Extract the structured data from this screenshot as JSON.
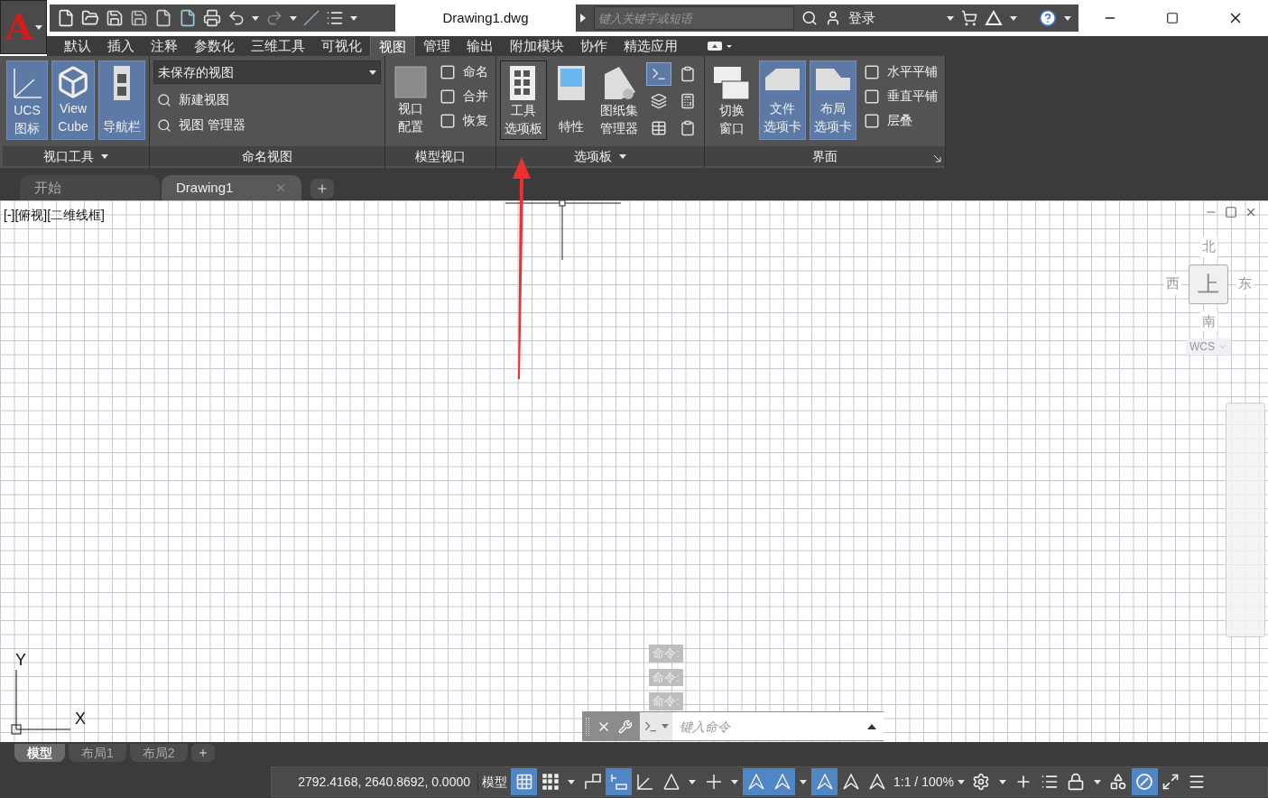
{
  "app_button": {
    "label": "A"
  },
  "title": "Drawing1.dwg",
  "search": {
    "placeholder": "键入关键字或短语"
  },
  "login": "登录",
  "ribbon_tabs": [
    {
      "label": "默认",
      "selected": false
    },
    {
      "label": "插入",
      "selected": false
    },
    {
      "label": "注释",
      "selected": false
    },
    {
      "label": "参数化",
      "selected": false
    },
    {
      "label": "三维工具",
      "selected": false
    },
    {
      "label": "可视化",
      "selected": false
    },
    {
      "label": "视图",
      "selected": true
    },
    {
      "label": "管理",
      "selected": false
    },
    {
      "label": "输出",
      "selected": false
    },
    {
      "label": "附加模块",
      "selected": false
    },
    {
      "label": "协作",
      "selected": false
    },
    {
      "label": "精选应用",
      "selected": false
    }
  ],
  "panels": [
    {
      "title": "视口工具",
      "caret": true,
      "launcher": false,
      "items": [
        {
          "kind": "large",
          "lines": [
            "UCS",
            "图标"
          ],
          "selected": true,
          "highlighted": false
        },
        {
          "kind": "large",
          "lines": [
            "View",
            "Cube"
          ],
          "selected": true,
          "highlighted": false
        },
        {
          "kind": "large",
          "lines": [
            "导航栏"
          ],
          "selected": true,
          "highlighted": false
        }
      ]
    },
    {
      "title": "命名视图",
      "caret": false,
      "launcher": false,
      "items": [
        {
          "kind": "dropdown",
          "value": "未保存的视图",
          "items": [
            "新建视图",
            "视图 管理器"
          ]
        }
      ]
    },
    {
      "title": "模型视口",
      "caret": false,
      "launcher": false,
      "items": [
        {
          "kind": "large",
          "lines": [
            "视口",
            "配置"
          ],
          "selected": false,
          "highlighted": false
        },
        {
          "kind": "column",
          "items": [
            "命名",
            "合并",
            "恢复"
          ]
        }
      ]
    },
    {
      "title": "选项板",
      "caret": true,
      "launcher": false,
      "items": [
        {
          "kind": "large",
          "lines": [
            "工具",
            "选项板"
          ],
          "selected": false,
          "highlighted": true
        },
        {
          "kind": "large",
          "lines": [
            "特性"
          ],
          "selected": false,
          "highlighted": false
        },
        {
          "kind": "large",
          "lines": [
            "图纸集",
            "管理器"
          ],
          "selected": false,
          "highlighted": false
        },
        {
          "kind": "grid",
          "icons": [
            {
              "selected": true
            },
            {
              "selected": false
            },
            {
              "selected": false
            },
            {
              "selected": false
            },
            {
              "selected": false
            },
            {
              "selected": false
            }
          ]
        }
      ]
    },
    {
      "title": "界面",
      "caret": false,
      "launcher": true,
      "items": [
        {
          "kind": "large",
          "lines": [
            "切换",
            "窗口"
          ],
          "selected": false,
          "highlighted": false
        },
        {
          "kind": "large",
          "lines": [
            "文件",
            "选项卡"
          ],
          "selected": true,
          "highlighted": false
        },
        {
          "kind": "large",
          "lines": [
            "布局",
            "选项卡"
          ],
          "selected": true,
          "highlighted": false
        },
        {
          "kind": "column",
          "items": [
            "水平平铺",
            "垂直平铺",
            "层叠"
          ]
        }
      ]
    }
  ],
  "file_tabs": [
    {
      "label": "开始",
      "selected": false
    },
    {
      "label": "Drawing1",
      "selected": true
    }
  ],
  "viewport_label": "[-][俯视][二维线框]",
  "viewcube": {
    "north": "北",
    "west": "西",
    "top": "上",
    "east": "东",
    "south": "南",
    "wcs": "WCS"
  },
  "command_history": [
    "命令:",
    "命令:",
    "命令:"
  ],
  "command_line": {
    "placeholder": "键入命令"
  },
  "ucs": {
    "x": "X",
    "y": "Y"
  },
  "layout_tabs": [
    {
      "label": "模型",
      "selected": true
    },
    {
      "label": "布局1",
      "selected": false
    },
    {
      "label": "布局2",
      "selected": false
    }
  ],
  "status_bar": {
    "coordinates": "2792.4168, 2640.8692, 0.0000",
    "space": "模型",
    "items": [
      {
        "kind": "toggle",
        "on": true
      },
      {
        "kind": "toggle",
        "on": false
      },
      {
        "kind": "caret"
      },
      {
        "kind": "toggle",
        "on": false
      },
      {
        "kind": "toggle",
        "on": true
      },
      {
        "kind": "toggle",
        "on": false
      },
      {
        "kind": "toggle",
        "on": false
      },
      {
        "kind": "caret"
      },
      {
        "kind": "toggle",
        "on": false
      },
      {
        "kind": "caret"
      },
      {
        "kind": "toggle",
        "on": true
      },
      {
        "kind": "toggle",
        "on": true
      },
      {
        "kind": "caret"
      },
      {
        "kind": "toggle",
        "on": true
      },
      {
        "kind": "toggle",
        "on": false
      },
      {
        "kind": "toggle",
        "on": false
      },
      {
        "kind": "scale",
        "text": "1:1 / 100%"
      },
      {
        "kind": "toggle",
        "on": false
      },
      {
        "kind": "caret"
      },
      {
        "kind": "toggle",
        "on": false
      },
      {
        "kind": "toggle",
        "on": false
      },
      {
        "kind": "toggle",
        "on": false
      },
      {
        "kind": "caret"
      },
      {
        "kind": "toggle",
        "on": false
      },
      {
        "kind": "toggle",
        "on": true
      },
      {
        "kind": "toggle",
        "on": false
      },
      {
        "kind": "toggle",
        "on": false
      }
    ]
  }
}
